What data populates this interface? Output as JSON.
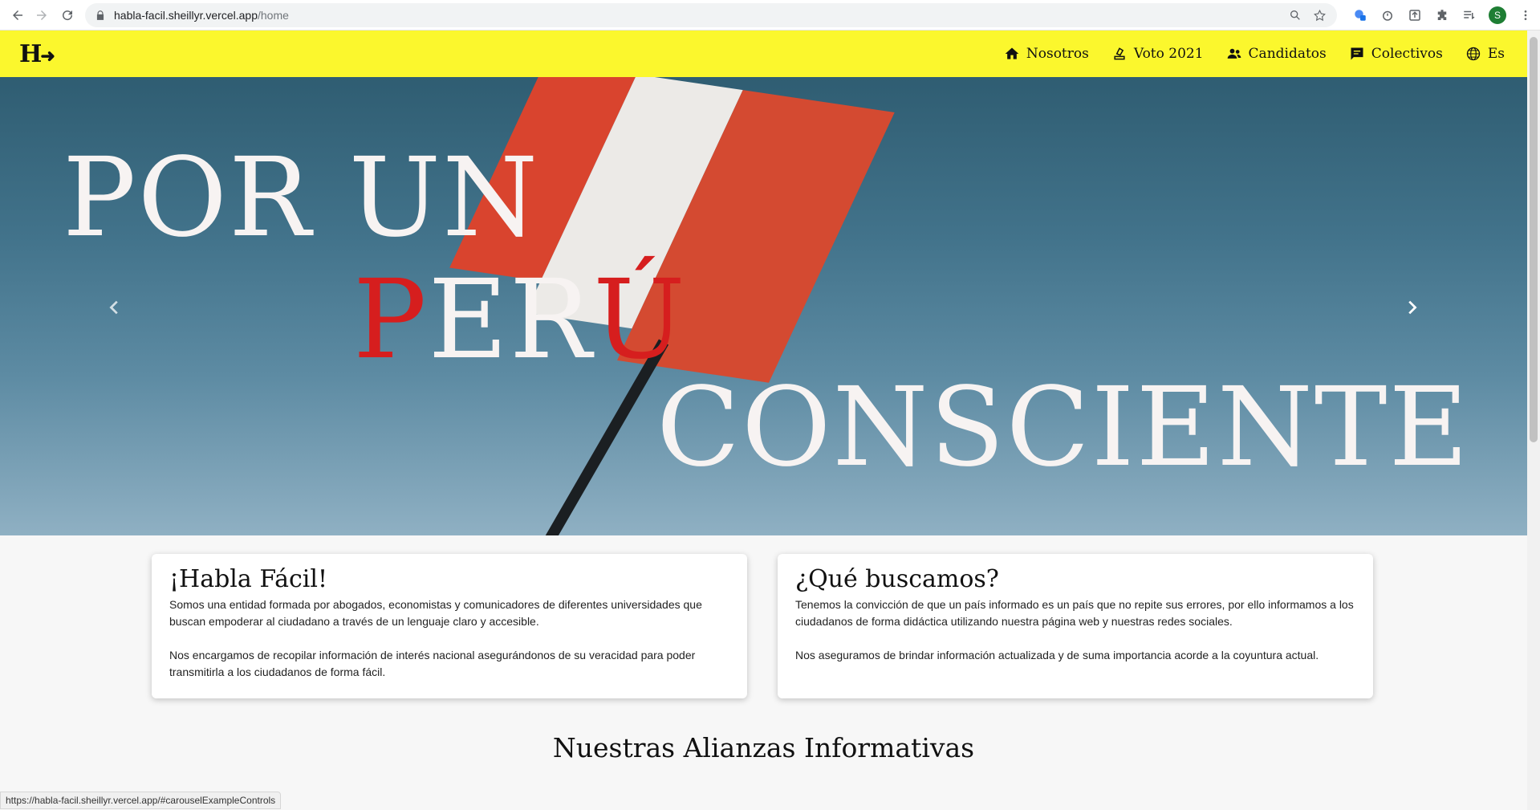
{
  "browser": {
    "url_host": "habla-facil.sheillyr.vercel.app",
    "url_path": "/home",
    "profile_initial": "S"
  },
  "site": {
    "logo": "H",
    "menu": [
      {
        "label": "Nosotros",
        "icon": "home-icon"
      },
      {
        "label": "Voto 2021",
        "icon": "ballot-icon"
      },
      {
        "label": "Candidatos",
        "icon": "people-icon"
      },
      {
        "label": "Colectivos",
        "icon": "chat-icon"
      },
      {
        "label": "Es",
        "icon": "globe-icon"
      }
    ]
  },
  "hero": {
    "line1": "POR UN",
    "line2_red1": "P",
    "line2_mid": "ER",
    "line2_red2": "Ú",
    "line3": "CONSCIENTE",
    "prev": "‹",
    "next": "›"
  },
  "cards": {
    "left": {
      "title": "¡Habla Fácil!",
      "p1": "Somos una entidad formada por abogados, economistas y comunicadores de diferentes universidades que buscan empoderar al ciudadano a través de un lenguaje claro y accesible.",
      "p2": "Nos encargamos de recopilar información de interés nacional asegurándonos de su veracidad para poder transmitirla a los ciudadanos de forma fácil."
    },
    "right": {
      "title": "¿Qué buscamos?",
      "p1": "Tenemos la convicción de que un país informado es un país que no repite sus errores, por ello informamos a los ciudadanos de forma didáctica utilizando nuestra página web y nuestras redes sociales.",
      "p2": "Nos aseguramos de brindar información actualizada y de suma importancia acorde a la coyuntura actual."
    }
  },
  "section_title": "Nuestras Alianzas Informativas",
  "status_url": "https://habla-facil.sheillyr.vercel.app/#carouselExampleControls",
  "colors": {
    "nav_bg": "#fbf72d",
    "accent_red": "#d61e1e"
  }
}
